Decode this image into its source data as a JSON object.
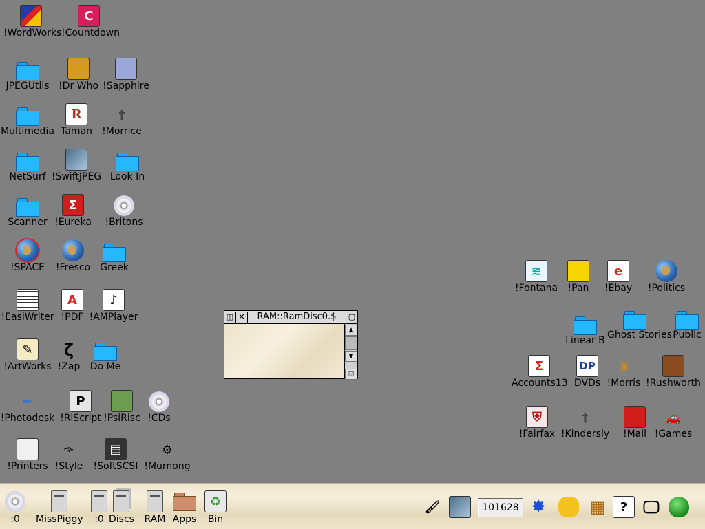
{
  "desktop": {
    "left_icons": [
      {
        "label": "!WordWorks",
        "icon": "wordworks-icon"
      },
      {
        "label": "!Countdown",
        "icon": "countdown-icon"
      },
      {
        "label": "JPEGUtils",
        "icon": "folder-icon"
      },
      {
        "label": "!Dr Who",
        "icon": "drwho-icon"
      },
      {
        "label": "!Sapphire",
        "icon": "sapphire-icon"
      },
      {
        "label": "Multimedia",
        "icon": "folder-icon"
      },
      {
        "label": "Taman",
        "icon": "document-icon"
      },
      {
        "label": "!Morrice",
        "icon": "dagger-icon"
      },
      {
        "label": "NetSurf",
        "icon": "folder-icon"
      },
      {
        "label": "!SwiftJPEG",
        "icon": "eye-icon"
      },
      {
        "label": "Look In",
        "icon": "folder-icon"
      },
      {
        "label": "Scanner",
        "icon": "folder-icon"
      },
      {
        "label": "!Eureka",
        "icon": "sigma-icon"
      },
      {
        "label": "!Britons",
        "icon": "cd-icon"
      },
      {
        "label": "!SPACE",
        "icon": "globe-ring-icon"
      },
      {
        "label": "!Fresco",
        "icon": "globe-icon"
      },
      {
        "label": "Greek",
        "icon": "folder-icon"
      },
      {
        "label": "!EasiWriter",
        "icon": "writer-icon"
      },
      {
        "label": "!PDF",
        "icon": "pdf-icon"
      },
      {
        "label": "!AMPlayer",
        "icon": "music-note-icon"
      },
      {
        "label": "!ArtWorks",
        "icon": "artworks-icon"
      },
      {
        "label": "!Zap",
        "icon": "zap-icon"
      },
      {
        "label": "Do Me",
        "icon": "folder-icon"
      },
      {
        "label": "!Photodesk",
        "icon": "photodesk-icon"
      },
      {
        "label": "!RiScript",
        "icon": "riscript-icon"
      },
      {
        "label": "!PsiRisc",
        "icon": "psion-icon"
      },
      {
        "label": "!CDs",
        "icon": "cd-icon"
      },
      {
        "label": "!Printers",
        "icon": "printer-icon"
      },
      {
        "label": "!Style",
        "icon": "quill-icon"
      },
      {
        "label": "!SoftSCSI",
        "icon": "floppy-icon"
      },
      {
        "label": "!Murnong",
        "icon": "projector-icon"
      }
    ],
    "right_icons": [
      {
        "label": "!Fontana",
        "icon": "fontana-icon"
      },
      {
        "label": "!Pan",
        "icon": "pan-icon"
      },
      {
        "label": "!Ebay",
        "icon": "ebay-icon"
      },
      {
        "label": "!Politics",
        "icon": "globe-icon"
      },
      {
        "label": "Linear B",
        "icon": "folder-icon"
      },
      {
        "label": "Ghost Stories",
        "icon": "folder-icon"
      },
      {
        "label": "Public",
        "icon": "folder-icon"
      },
      {
        "label": "Accounts13",
        "icon": "accounts-icon"
      },
      {
        "label": "DVDs",
        "icon": "dp-icon"
      },
      {
        "label": "!Morris",
        "icon": "castle-icon"
      },
      {
        "label": "!Rushworth",
        "icon": "book-icon"
      },
      {
        "label": "!Fairfax",
        "icon": "shield-icon"
      },
      {
        "label": "!Kindersly",
        "icon": "dagger-icon"
      },
      {
        "label": "!Mail",
        "icon": "postbox-icon"
      },
      {
        "label": "!Games",
        "icon": "car-icon"
      }
    ]
  },
  "filer_window": {
    "title": "RAM::RamDisc0.$",
    "back_glyph": "◫",
    "close_glyph": "✕",
    "toggle_glyph": "▢",
    "scroll_up": "▲",
    "scroll_down": "▼",
    "resize_glyph": "◲"
  },
  "iconbar": {
    "left": [
      {
        "label": ":0",
        "icon": "cd-drive-icon"
      },
      {
        "label": "MissPiggy",
        "icon": "hard-drive-icon"
      },
      {
        "label": ":0",
        "icon": "floppy-drive-icon"
      },
      {
        "label": "Discs",
        "icon": "discs-icon"
      },
      {
        "label": "RAM",
        "icon": "ram-drive-icon"
      },
      {
        "label": "Apps",
        "icon": "apps-folder-icon"
      },
      {
        "label": "Bin",
        "icon": "recycle-bin-icon"
      }
    ],
    "clock": "101628",
    "right_icons": [
      "paintbrush-icon",
      "eye-icon",
      "starburst-icon",
      "mouse-icon",
      "calculator-icon",
      "help-icon",
      "display-icon",
      "acorn-icon"
    ]
  }
}
